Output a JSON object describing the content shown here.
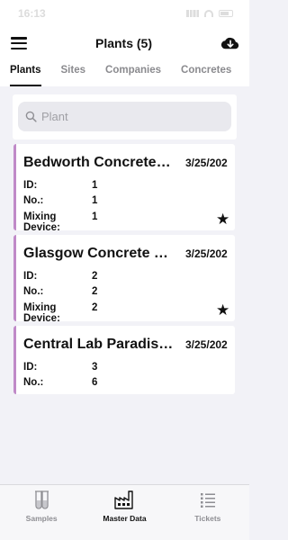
{
  "status_bar": {
    "time": "16:13"
  },
  "header": {
    "title": "Plants (5)",
    "menu_icon": "hamburger-menu-icon",
    "action_icon": "cloud-download-icon"
  },
  "tabs": [
    {
      "label": "Plants",
      "active": true
    },
    {
      "label": "Sites",
      "active": false
    },
    {
      "label": "Companies",
      "active": false
    },
    {
      "label": "Concretes",
      "active": false
    }
  ],
  "search": {
    "placeholder": "Plant"
  },
  "plants": [
    {
      "name": "Bedworth Concrete Lt...",
      "date": "3/25/202",
      "id_label": "ID:",
      "id": "1",
      "no_label": "No.:",
      "no": "1",
      "mixing_label": "Mixing Device:",
      "mixing": "1",
      "favorite": true
    },
    {
      "name": "Glasgow Concrete Ltd...",
      "date": "3/25/202",
      "id_label": "ID:",
      "id": "2",
      "no_label": "No.:",
      "no": "2",
      "mixing_label": "Mixing Device:",
      "mixing": "2",
      "favorite": true
    },
    {
      "name": "Central Lab Paradise...",
      "date": "3/25/202",
      "id_label": "ID:",
      "id": "3",
      "no_label": "No.:",
      "no": "6"
    }
  ],
  "bottom_nav": [
    {
      "label": "Samples",
      "icon": "test-tubes-icon",
      "active": false
    },
    {
      "label": "Master Data",
      "icon": "factory-icon",
      "active": true
    },
    {
      "label": "Tickets",
      "icon": "list-icon",
      "active": false
    }
  ],
  "colors": {
    "accent_border": "#c08ac8",
    "background": "#f2f2f7"
  }
}
